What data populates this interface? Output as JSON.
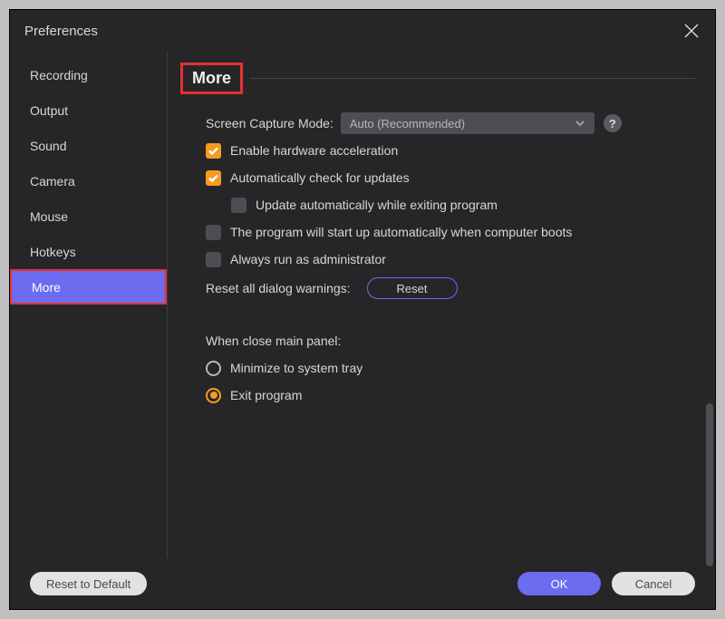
{
  "window": {
    "title": "Preferences"
  },
  "sidebar": {
    "items": [
      {
        "label": "Recording"
      },
      {
        "label": "Output"
      },
      {
        "label": "Sound"
      },
      {
        "label": "Camera"
      },
      {
        "label": "Mouse"
      },
      {
        "label": "Hotkeys"
      },
      {
        "label": "More"
      }
    ],
    "selected_index": 6
  },
  "panel": {
    "heading": "More",
    "capture_mode_label": "Screen Capture Mode:",
    "capture_mode_value": "Auto (Recommended)",
    "options": {
      "hw_accel": "Enable hardware acceleration",
      "auto_check_updates": "Automatically check for updates",
      "auto_update_on_exit": "Update automatically while exiting program",
      "start_on_boot": "The program will start up automatically when computer boots",
      "run_as_admin": "Always run as administrator"
    },
    "reset_warnings_label": "Reset all dialog warnings:",
    "reset_button": "Reset",
    "close_panel_label": "When close main panel:",
    "close_panel_options": {
      "minimize": "Minimize to system tray",
      "exit": "Exit program"
    },
    "close_panel_selected": "exit"
  },
  "footer": {
    "reset_default": "Reset to Default",
    "ok": "OK",
    "cancel": "Cancel"
  }
}
